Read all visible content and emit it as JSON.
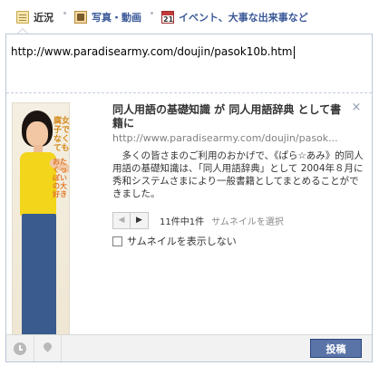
{
  "tabs": [
    {
      "label": "近況",
      "icon": "status-update-icon",
      "active": true
    },
    {
      "label": "写真・動画",
      "icon": "photo-video-icon",
      "active": false
    },
    {
      "label": "イベント、大事な出来事など",
      "icon": "calendar-icon",
      "active": false
    }
  ],
  "composer": {
    "url_value": "http://www.paradisearmy.com/doujin/pasok10b.htm"
  },
  "preview": {
    "title": "同人用語の基礎知識 が 同人用語辞典 として書籍に",
    "url": "http://www.paradisearmy.com/doujin/pasok...",
    "description": "　多くの皆さまのご利用のおかげで、《ぱら☆あみ》的同人用語の基礎知識は、「同人用語辞典」として 2004年８月に秀和システムさまにより一般書籍としてまとめることができました。",
    "thumbnail_text_1": "腐女子でなくても",
    "thumbnail_text_2": "おたくっぽいの大好き",
    "close_icon": "×",
    "pager_prev": "◀",
    "pager_next": "▶",
    "pager_count": "11件中1件",
    "pager_select": "サムネイルを選択",
    "no_thumbnail_label": "サムネイルを表示しない"
  },
  "footer": {
    "post_label": "投稿"
  },
  "colors": {
    "brand": "#3b5998",
    "post_button": "#5b74a8",
    "border": "#bdc7d8"
  }
}
